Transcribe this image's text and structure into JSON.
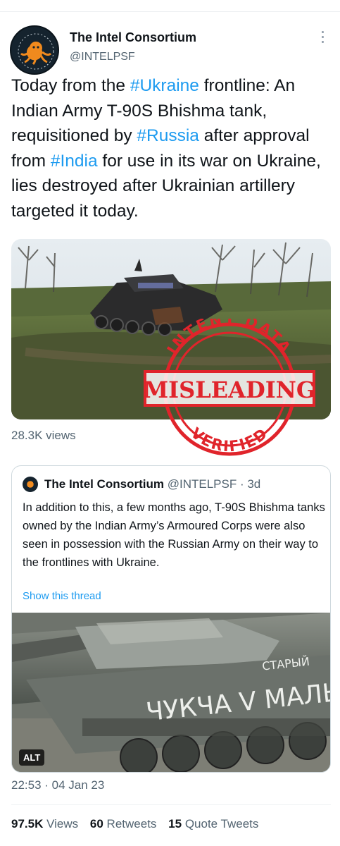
{
  "tweet": {
    "author_name": "The Intel Consortium",
    "author_handle": "@INTELPSF",
    "text_parts": [
      {
        "text": "Today from the ",
        "tag": false
      },
      {
        "text": "#Ukraine",
        "tag": true
      },
      {
        "text": " frontline: An Indian Army T-90S Bhishma tank, requisitioned by ",
        "tag": false
      },
      {
        "text": "#Russia",
        "tag": true
      },
      {
        "text": " after approval from ",
        "tag": false
      },
      {
        "text": "#India",
        "tag": true
      },
      {
        "text": " for use in its war on Ukraine, lies destroyed after Ukrainian artillery targeted it today.",
        "tag": false
      }
    ],
    "views": "28.3K views",
    "timestamp": "22:53 · 04 Jan 23"
  },
  "stamp": {
    "top_text": "INTENT DATA",
    "label": "MISLEADING",
    "bottom_text": "VERIFIED",
    "color": "#e0242b"
  },
  "quote": {
    "author_name": "The Intel Consortium",
    "author_handle": "@INTELPSF",
    "age": "· 3d",
    "text": "In addition to this, a few months ago, T-90S Bhishma tanks owned by the Indian Army’s Armoured Corps were also seen in possession with the Russian Army on their way to the frontlines with Ukraine.",
    "show_thread": "Show this thread",
    "alt_badge": "ALT",
    "tank_writing_main": "ЧУКЧА V МАЛЫШ",
    "tank_writing_top": "СТАРЫЙ"
  },
  "stats": {
    "views_count": "97.5K",
    "views_label": "Views",
    "retweets_count": "60",
    "retweets_label": "Retweets",
    "quotes_count": "15",
    "quotes_label": "Quote Tweets"
  },
  "colors": {
    "link": "#1d9bf0",
    "muted": "#536471",
    "text": "#0f1419"
  }
}
